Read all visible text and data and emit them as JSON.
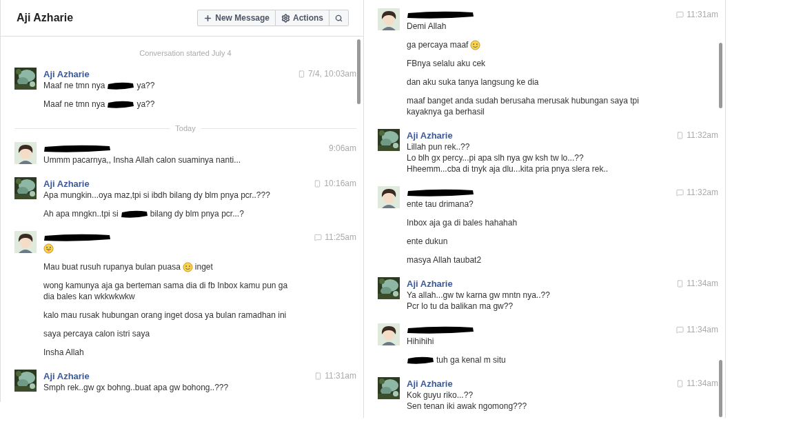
{
  "header": {
    "title": "Aji Azharie",
    "buttons": [
      {
        "label": "New Message"
      },
      {
        "label": "Actions"
      }
    ]
  },
  "panes": [
    {
      "items": [
        {
          "kind": "notice",
          "text": "Conversation started July 4"
        },
        {
          "kind": "named_mobile",
          "sender": "Aji Azharie",
          "time": "7/4, 10:03am",
          "messages": [
            {
              "parts": [
                {
                  "kind": "text",
                  "text": "Maaf ne tmn nya"
                },
                {
                  "kind": "redaction"
                },
                {
                  "kind": "text",
                  "text": "ya??"
                }
              ]
            },
            {
              "parts": [
                {
                  "kind": "text",
                  "text": "Maaf ne tmn nya"
                },
                {
                  "kind": "redaction"
                },
                {
                  "kind": "text",
                  "text": "ya??"
                }
              ]
            }
          ]
        },
        {
          "kind": "separator",
          "text": "Today"
        },
        {
          "kind": "redacted_plain",
          "time": "9:06am",
          "messages": [
            {
              "text": "Ummm pacarnya,, Insha Allah calon suaminya nanti..."
            }
          ]
        },
        {
          "kind": "named_mobile",
          "sender": "Aji Azharie",
          "time": "10:16am",
          "messages": [
            {
              "text": "Apa mungkin...oya maz,tpi si ibdh bilang dy blm pnya pcr..???"
            },
            {
              "parts": [
                {
                  "kind": "text",
                  "text": "Ah apa mngkn..tpi si"
                },
                {
                  "kind": "redaction"
                },
                {
                  "kind": "text",
                  "text": "bilang dy blm pnya pcr...?"
                }
              ]
            }
          ]
        },
        {
          "kind": "redacted_chat",
          "time": "11:25am",
          "messages": [
            {
              "parts": [
                {
                  "kind": "tongue"
                }
              ]
            },
            {
              "parts": [
                {
                  "kind": "text",
                  "text": "Mau buat rusuh rupanya bulan puasa"
                },
                {
                  "kind": "smiley"
                },
                {
                  "kind": "text",
                  "text": "inget"
                }
              ]
            },
            {
              "text": "wong kamunya aja ga berteman sama dia di fb Inbox kamu pun ga\ndia bales kan wkkwkwkw"
            },
            {
              "text": "kalo mau rusak hubungan orang inget dosa ya bulan ramadhan ini"
            },
            {
              "text": "saya percaya calon istri saya"
            },
            {
              "text": "Insha Allah"
            }
          ]
        },
        {
          "kind": "named_mobile",
          "sender": "Aji Azharie",
          "time": "11:31am",
          "messages": [
            {
              "text": "Smph rek..gw gx bohng..buat apa gw bohong..???"
            }
          ]
        }
      ]
    },
    {
      "items": [
        {
          "kind": "redacted_chat",
          "time": "11:31am",
          "messages": [
            {
              "text": "Demi Allah"
            },
            {
              "parts": [
                {
                  "kind": "text",
                  "text": "ga percaya maaf"
                },
                {
                  "kind": "smiley"
                }
              ]
            },
            {
              "text": "FBnya selalu aku cek"
            },
            {
              "text": "dan aku suka tanya langsung ke dia"
            },
            {
              "text": "maaf banget anda sudah berusaha merusak hubungan saya tpi\nkayaknya ga berhasil"
            }
          ]
        },
        {
          "kind": "named_mobile",
          "sender": "Aji Azharie",
          "time": "11:32am",
          "messages": [
            {
              "text": "Lillah pun rek..??\nLo blh gx percy...pi apa slh nya gw ksh tw lo...??\nHheemm...cba di tnyk aja dlu...kita pria pnya slera rek.."
            }
          ]
        },
        {
          "kind": "redacted_chat",
          "time": "11:32am",
          "messages": [
            {
              "text": "ente tau drimana?"
            },
            {
              "text": "Inbox aja ga di bales hahahah"
            },
            {
              "text": "ente dukun"
            },
            {
              "text": "masya Allah taubat2"
            }
          ]
        },
        {
          "kind": "named_mobile",
          "sender": "Aji Azharie",
          "time": "11:34am",
          "messages": [
            {
              "text": "Ya allah...gw tw karna gw mntn nya..??\nPcr lo tu da balikan ma gw??"
            }
          ]
        },
        {
          "kind": "redacted_chat",
          "time": "11:34am",
          "messages": [
            {
              "text": "Hihihihi"
            },
            {
              "parts": [
                {
                  "kind": "redaction"
                },
                {
                  "kind": "text",
                  "text": "tuh ga kenal m situ"
                }
              ]
            }
          ]
        },
        {
          "kind": "named_mobile",
          "sender": "Aji Azharie",
          "time": "11:34am",
          "messages": [
            {
              "text": "Kok guyu riko...??\nSen tenan iki awak ngomong???"
            }
          ]
        }
      ]
    }
  ]
}
